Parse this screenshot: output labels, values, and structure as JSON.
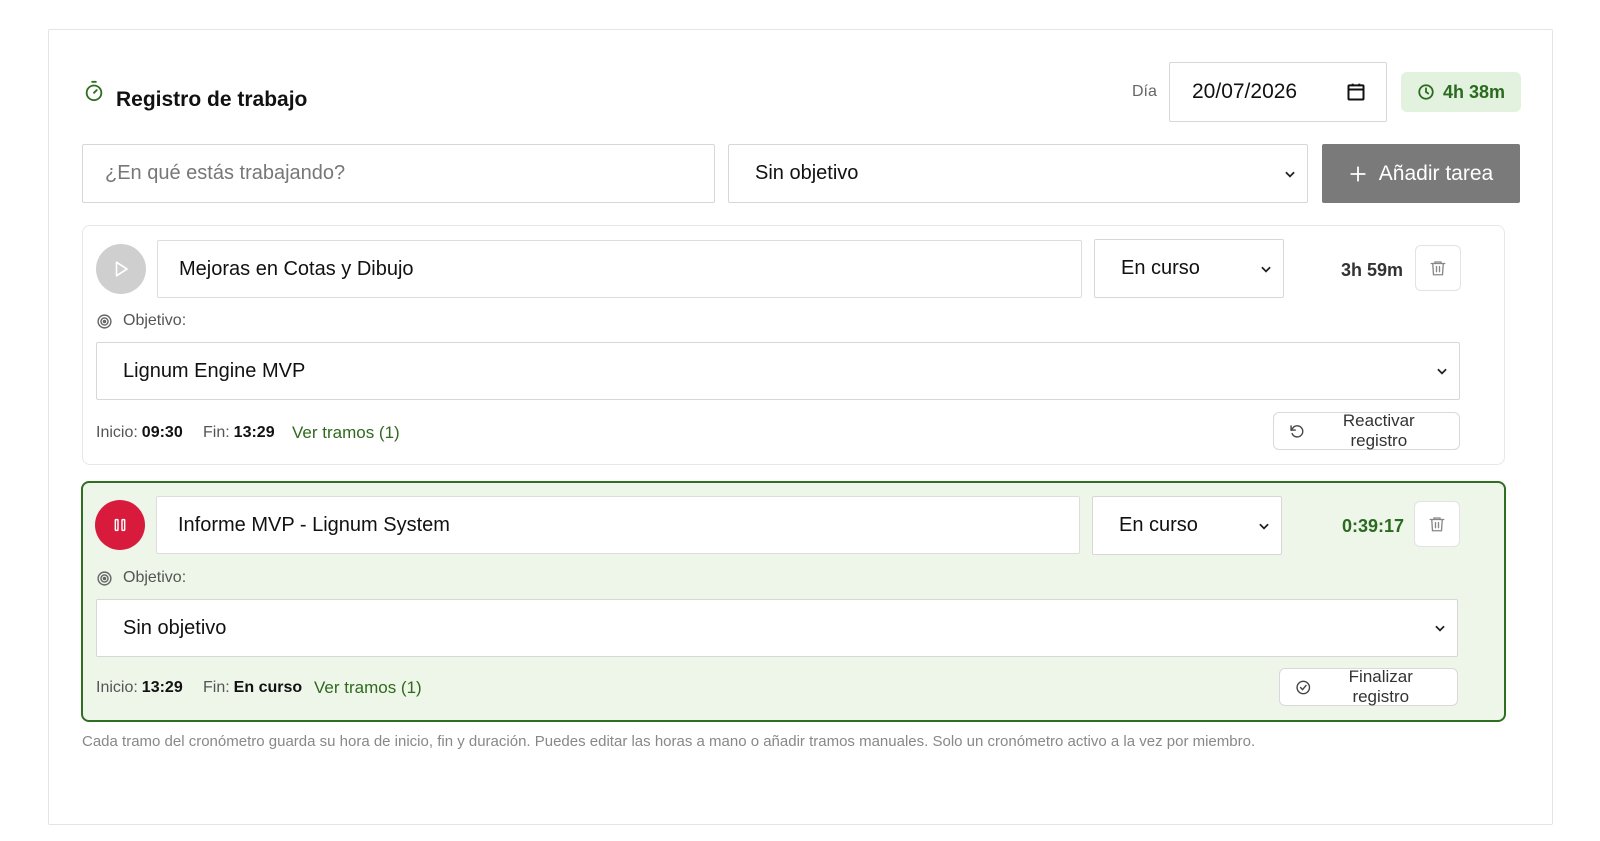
{
  "header": {
    "title": "Registro de trabajo",
    "day_label": "Día",
    "date_value": "20/07/2026",
    "total_time": "4h 38m"
  },
  "new_task": {
    "placeholder": "¿En qué estás trabajando?",
    "objective_select": "Sin objetivo",
    "add_button": "Añadir tarea"
  },
  "tasks": [
    {
      "name": "Mejoras en Cotas y Dibujo",
      "status": "En curso",
      "duration": "3h 59m",
      "objective_label": "Objetivo:",
      "objective": "Lignum Engine MVP",
      "start_label": "Inicio:",
      "start": "09:30",
      "end_label": "Fin:",
      "end": "13:29",
      "segments_link": "Ver tramos (1)",
      "action_button": "Reactivar registro",
      "running": false
    },
    {
      "name": "Informe MVP - Lignum System",
      "status": "En curso",
      "duration": "0:39:17",
      "objective_label": "Objetivo:",
      "objective": "Sin objetivo",
      "start_label": "Inicio:",
      "start": "13:29",
      "end_label": "Fin:",
      "end": "En curso",
      "segments_link": "Ver tramos (1)",
      "action_button": "Finalizar registro",
      "running": true
    }
  ],
  "footnote": "Cada tramo del cronómetro guarda su hora de inicio, fin y duración. Puedes editar las horas a mano o añadir tramos manuales. Solo un cronómetro activo a la vez por miembro.",
  "colors": {
    "accent_green": "#2f6f22",
    "active_bg": "#eef6ea",
    "badge_bg": "#e3f1df",
    "pause_red": "#d81b3c",
    "add_button_bg": "#7a7a7a"
  },
  "icons": [
    "stopwatch-icon",
    "calendar-icon",
    "clock-icon",
    "plus-icon",
    "play-icon",
    "pause-icon",
    "trash-icon",
    "target-icon",
    "rotate-ccw-icon",
    "check-circle-icon",
    "chevron-down-icon"
  ]
}
